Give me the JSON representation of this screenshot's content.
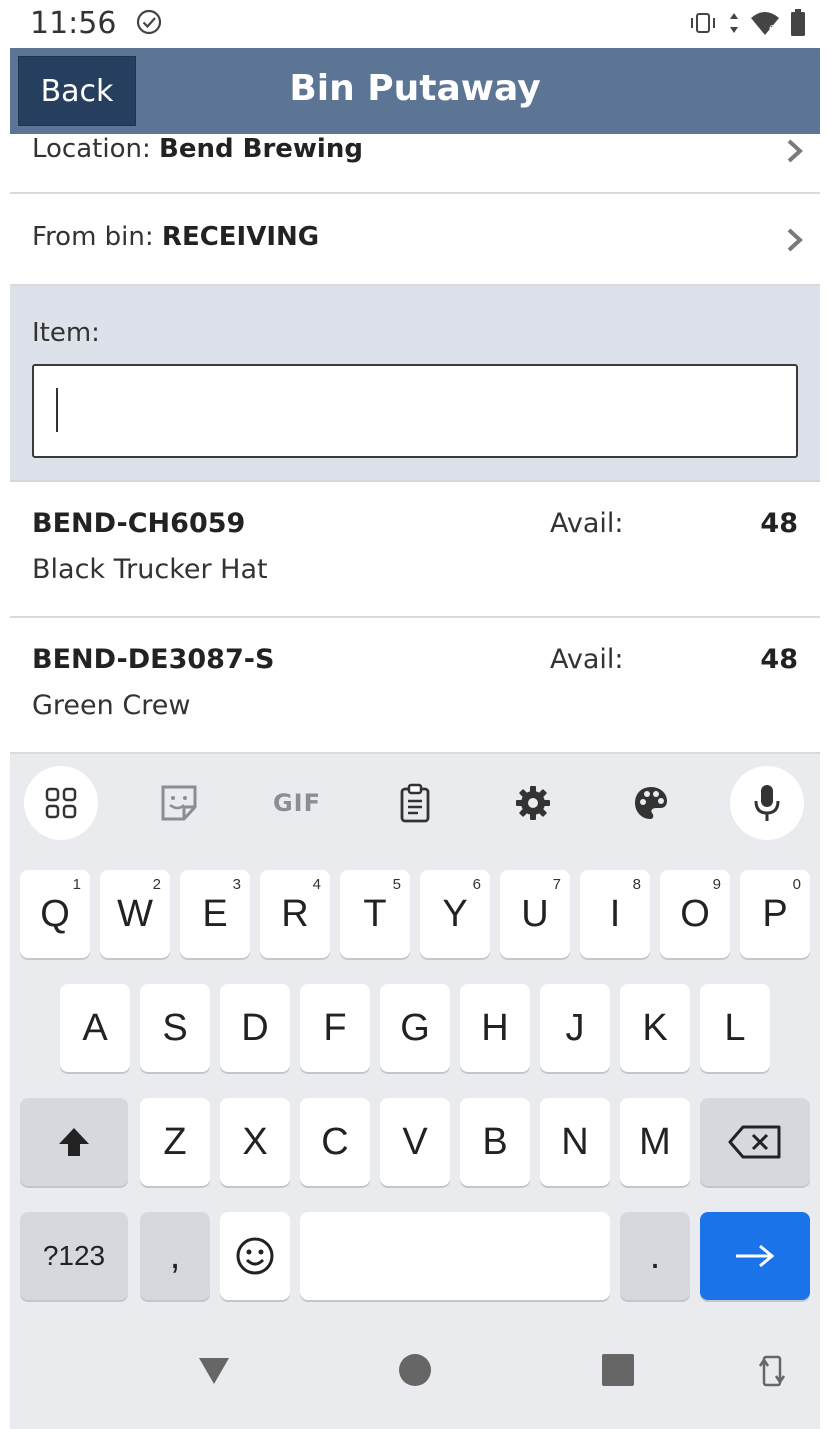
{
  "status_bar": {
    "time": "11:56",
    "icons": [
      "check-circle-icon",
      "vibrate-icon",
      "data-arrows-icon",
      "wifi-icon",
      "battery-icon"
    ]
  },
  "app_bar": {
    "back_label": "Back",
    "title": "Bin Putaway",
    "color": "#5c7594",
    "back_color": "#273f5f"
  },
  "location": {
    "label": "Location: ",
    "value": "Bend Brewing"
  },
  "from_bin": {
    "label": "From bin: ",
    "value": "RECEIVING"
  },
  "item": {
    "label": "Item:",
    "value": "",
    "placeholder": ""
  },
  "items": [
    {
      "code": "BEND-CH6059",
      "name": "Black Trucker Hat",
      "avail_label": "Avail:",
      "qty": "48"
    },
    {
      "code": "BEND-DE3087-S",
      "name": "Green Crew",
      "avail_label": "Avail:",
      "qty": "48"
    }
  ],
  "keyboard": {
    "toolbar": {
      "gif_label": "GIF",
      "icons": [
        "apps-grid-icon",
        "sticker-icon",
        "gif-icon",
        "clipboard-icon",
        "settings-icon",
        "palette-icon",
        "mic-icon"
      ]
    },
    "row1": [
      "Q",
      "W",
      "E",
      "R",
      "T",
      "Y",
      "U",
      "I",
      "O",
      "P"
    ],
    "row1_numbers": [
      "1",
      "2",
      "3",
      "4",
      "5",
      "6",
      "7",
      "8",
      "9",
      "0"
    ],
    "row2": [
      "A",
      "S",
      "D",
      "F",
      "G",
      "H",
      "J",
      "K",
      "L"
    ],
    "row3": [
      "Z",
      "X",
      "C",
      "V",
      "B",
      "N",
      "M"
    ],
    "symbols_label": "?123",
    "comma": ",",
    "period": ".",
    "enter_color": "#1a73e8"
  },
  "nav_bar": {
    "icons": [
      "back-triangle-icon",
      "home-circle-icon",
      "recents-square-icon",
      "rotate-icon"
    ]
  }
}
